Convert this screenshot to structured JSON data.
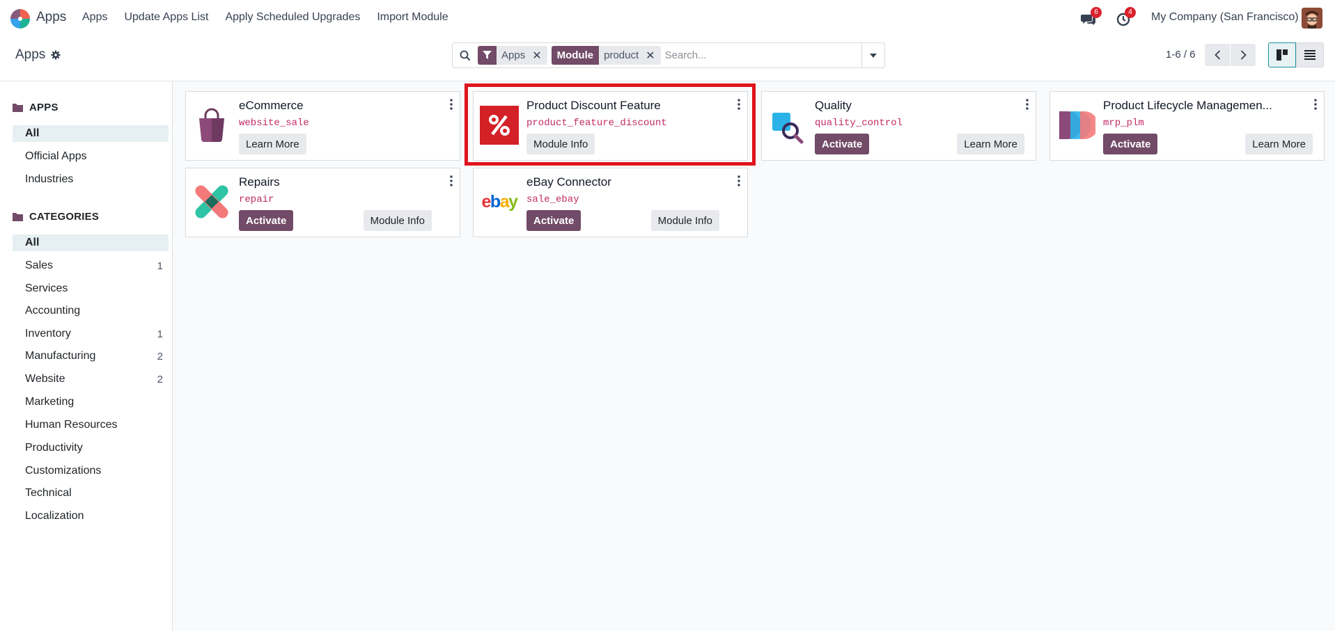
{
  "topbar": {
    "app_name": "Apps",
    "menu": [
      "Apps",
      "Update Apps List",
      "Apply Scheduled Upgrades",
      "Import Module"
    ],
    "messages_badge": "6",
    "activities_badge": "4",
    "company": "My Company (San Francisco)"
  },
  "control": {
    "breadcrumb": "Apps",
    "facets": [
      {
        "label_icon": "filter-icon",
        "value": "Apps"
      },
      {
        "label": "Module",
        "value": "product"
      }
    ],
    "search_placeholder": "Search...",
    "pager": "1-6 / 6"
  },
  "sidebar": {
    "apps_heading": "APPS",
    "apps_items": [
      {
        "label": "All",
        "active": true
      },
      {
        "label": "Official Apps"
      },
      {
        "label": "Industries"
      }
    ],
    "categories_heading": "CATEGORIES",
    "category_items": [
      {
        "label": "All",
        "active": true,
        "count": ""
      },
      {
        "label": "Sales",
        "count": "1"
      },
      {
        "label": "Services",
        "count": ""
      },
      {
        "label": "Accounting",
        "count": ""
      },
      {
        "label": "Inventory",
        "count": "1"
      },
      {
        "label": "Manufacturing",
        "count": "2"
      },
      {
        "label": "Website",
        "count": "2"
      },
      {
        "label": "Marketing",
        "count": ""
      },
      {
        "label": "Human Resources",
        "count": ""
      },
      {
        "label": "Productivity",
        "count": ""
      },
      {
        "label": "Customizations",
        "count": ""
      },
      {
        "label": "Technical",
        "count": ""
      },
      {
        "label": "Localization",
        "count": ""
      }
    ]
  },
  "cards": [
    {
      "title": "eCommerce",
      "tech": "website_sale",
      "icon": "shopping-bag-icon",
      "buttons": [
        "Learn More"
      ]
    },
    {
      "title": "Product Discount Feature",
      "tech": "product_feature_discount",
      "icon": "percent-icon",
      "buttons": [
        "Module Info"
      ]
    },
    {
      "title": "Quality",
      "tech": "quality_control",
      "icon": "quality-icon",
      "buttons": [
        "Activate",
        "Learn More"
      ]
    },
    {
      "title": "Product Lifecycle Managemen...",
      "tech": "mrp_plm",
      "icon": "plm-icon",
      "buttons": [
        "Activate",
        "Learn More"
      ]
    },
    {
      "title": "Repairs",
      "tech": "repair",
      "icon": "repairs-icon",
      "buttons": [
        "Activate",
        "Module Info"
      ]
    },
    {
      "title": "eBay Connector",
      "tech": "sale_ebay",
      "icon": "ebay-logo",
      "ebay_logo_text": "ebay",
      "buttons": [
        "Activate",
        "Module Info"
      ]
    }
  ],
  "colors": {
    "primary": "#714b67",
    "highlight": "#e0141e",
    "technical_name": "#c12a64",
    "badge": "#d9212c"
  }
}
